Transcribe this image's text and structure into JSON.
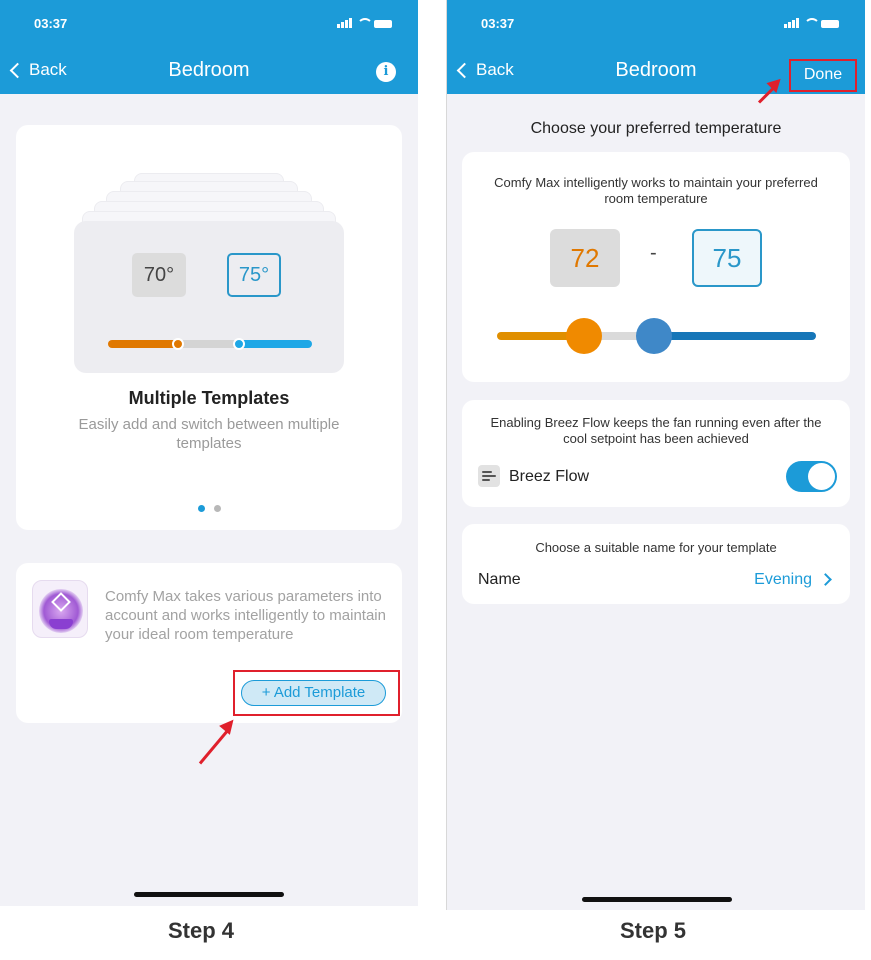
{
  "status_time": "03:37",
  "colors": {
    "header": "#1c9bd8",
    "warm": "#e07800",
    "cool": "#1c9bd8",
    "highlight": "#e0202c"
  },
  "step4": {
    "header": {
      "back_label": "Back",
      "title": "Bedroom",
      "info_icon": "info-icon"
    },
    "template_card": {
      "low_temp": "70°",
      "high_temp": "75°",
      "title": "Multiple Templates",
      "subtitle": "Easily add and switch between multiple templates",
      "page_count": 2,
      "active_page": 1
    },
    "add_card": {
      "description": "Comfy Max takes various parameters into account and works intelligently to maintain your ideal room temperature",
      "add_button_label": "+ Add Template"
    },
    "caption": "Step 4"
  },
  "step5": {
    "header": {
      "back_label": "Back",
      "title": "Bedroom",
      "done_label": "Done"
    },
    "choose_heading": "Choose your preferred temperature",
    "temp_card": {
      "description": "Comfy Max intelligently works to maintain your preferred room temperature",
      "low_value": "72",
      "separator": "-",
      "high_value": "75"
    },
    "breez_card": {
      "description": "Enabling Breez Flow keeps the fan running even after the cool setpoint has been achieved",
      "label": "Breez Flow",
      "enabled": true
    },
    "name_card": {
      "description": "Choose a suitable name for your template",
      "label": "Name",
      "value": "Evening"
    },
    "caption": "Step 5"
  }
}
